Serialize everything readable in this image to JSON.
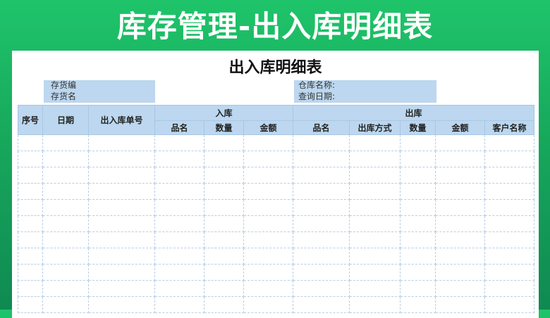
{
  "banner_title": "库存管理-出入库明细表",
  "sheet": {
    "title": "出入库明细表",
    "info_left": {
      "line1": "存货编",
      "line2": "存货名"
    },
    "info_right": {
      "line1": "仓库名称:",
      "line2": "查询日期:"
    }
  },
  "table": {
    "headers": {
      "seq": "序号",
      "date": "日期",
      "doc_no": "出入库单号",
      "in_group": "入库",
      "out_group": "出库",
      "in_cols": [
        "品名",
        "数量",
        "金额"
      ],
      "out_cols": [
        "品名",
        "出库方式",
        "数量",
        "金额",
        "客户名称"
      ]
    },
    "empty_rows": 11
  }
}
